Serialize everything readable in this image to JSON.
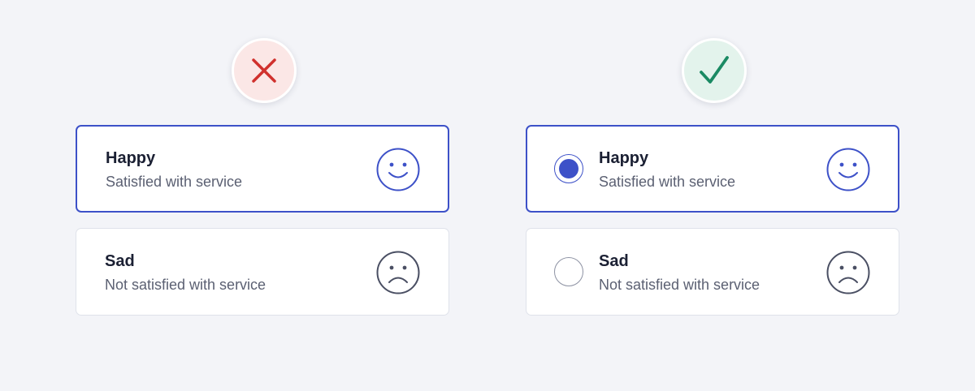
{
  "colors": {
    "accent": "#3d51c8",
    "error": "#d0312d",
    "error_bg": "#fbe7e6",
    "success": "#1a8a63",
    "success_bg": "#e3f3ec",
    "neutral_icon": "#4a4f63"
  },
  "icons": {
    "dont": "x-icon",
    "do": "checkmark-icon",
    "happy": "smiley-face-icon",
    "sad": "frowning-face-icon"
  },
  "incorrect_example": {
    "options": [
      {
        "title": "Happy",
        "description": "Satisfied with service",
        "selected": true
      },
      {
        "title": "Sad",
        "description": "Not satisfied with service",
        "selected": false
      }
    ]
  },
  "correct_example": {
    "options": [
      {
        "title": "Happy",
        "description": "Satisfied with service",
        "selected": true
      },
      {
        "title": "Sad",
        "description": "Not satisfied with service",
        "selected": false
      }
    ]
  }
}
